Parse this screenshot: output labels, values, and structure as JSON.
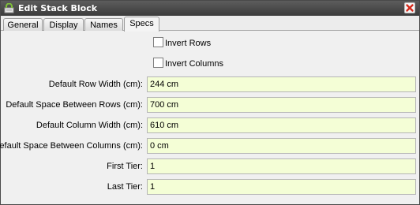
{
  "window": {
    "title": "Edit Stack Block"
  },
  "tabs": [
    {
      "label": "General"
    },
    {
      "label": "Display"
    },
    {
      "label": "Names"
    },
    {
      "label": "Specs"
    }
  ],
  "active_tab": "Specs",
  "checkboxes": {
    "invert_rows": {
      "label": "Invert Rows",
      "checked": false
    },
    "invert_columns": {
      "label": "Invert Columns",
      "checked": false
    }
  },
  "fields": {
    "row_width": {
      "label": "Default Row Width (cm):",
      "value": "244 cm"
    },
    "space_rows": {
      "label": "Default Space Between Rows (cm):",
      "value": "700 cm"
    },
    "column_width": {
      "label": "Default Column Width (cm):",
      "value": "610 cm"
    },
    "space_columns": {
      "label": "Default Space Between Columns (cm):",
      "value": "0 cm"
    },
    "first_tier": {
      "label": "First Tier:",
      "value": "1"
    },
    "last_tier": {
      "label": "Last Tier:",
      "value": "1"
    }
  },
  "colors": {
    "titlebar": "#454545",
    "close_x": "#d42a1c",
    "input_bg": "#f4fed6"
  },
  "icons": {
    "title": "stack-icon",
    "close": "close-icon"
  }
}
